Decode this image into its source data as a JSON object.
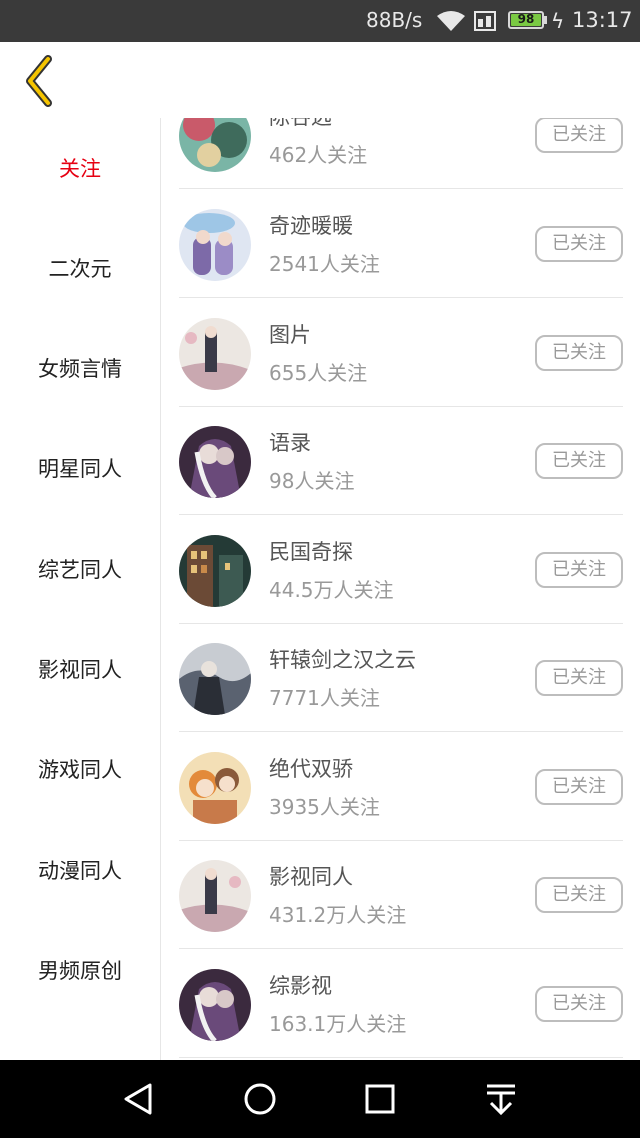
{
  "status_bar": {
    "network_speed": "88B/s",
    "battery_level": "98",
    "time": "13:17"
  },
  "header": {
    "back_icon": "chevron-left-icon",
    "accent_color": "#f5c400"
  },
  "sidebar": {
    "active_color": "#e60012",
    "items": [
      {
        "label": "关注",
        "active": true
      },
      {
        "label": "二次元",
        "active": false
      },
      {
        "label": "女频言情",
        "active": false
      },
      {
        "label": "明星同人",
        "active": false
      },
      {
        "label": "综艺同人",
        "active": false
      },
      {
        "label": "影视同人",
        "active": false
      },
      {
        "label": "游戏同人",
        "active": false
      },
      {
        "label": "动漫同人",
        "active": false
      },
      {
        "label": "男频原创",
        "active": false
      }
    ]
  },
  "list": {
    "items": [
      {
        "name": "陈谷远",
        "followers": "462人关注",
        "button": "已关注"
      },
      {
        "name": "奇迹暖暖",
        "followers": "2541人关注",
        "button": "已关注"
      },
      {
        "name": "图片",
        "followers": "655人关注",
        "button": "已关注"
      },
      {
        "name": "语录",
        "followers": "98人关注",
        "button": "已关注"
      },
      {
        "name": "民国奇探",
        "followers": "44.5万人关注",
        "button": "已关注"
      },
      {
        "name": "轩辕剑之汉之云",
        "followers": "7771人关注",
        "button": "已关注"
      },
      {
        "name": "绝代双骄",
        "followers": "3935人关注",
        "button": "已关注"
      },
      {
        "name": "影视同人",
        "followers": "431.2万人关注",
        "button": "已关注"
      },
      {
        "name": "综影视",
        "followers": "163.1万人关注",
        "button": "已关注"
      }
    ]
  },
  "nav_bar": {
    "icons": [
      "back-triangle-icon",
      "home-circle-icon",
      "recents-square-icon",
      "notification-pulldown-icon"
    ]
  }
}
